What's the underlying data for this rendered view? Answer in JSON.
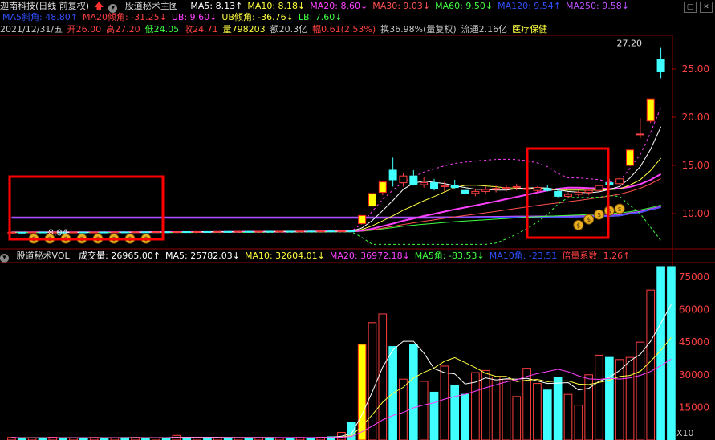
{
  "header": {
    "title": "迦南科技(日线 前复权)",
    "indicator_name": "股道秘术主图",
    "ma": [
      {
        "label": "MA5: 8.13↑",
        "color": "#ffffff"
      },
      {
        "label": "MA10: 8.18↓",
        "color": "#ffff40"
      },
      {
        "label": "MA20: 8.60↓",
        "color": "#ff40ff"
      },
      {
        "label": "MA30: 9.03↓",
        "color": "#ff5050"
      },
      {
        "label": "MA60: 9.50↓",
        "color": "#40ff40"
      },
      {
        "label": "MA120: 9.54↑",
        "color": "#3050ff"
      },
      {
        "label": "MA250: 9.58↓",
        "color": "#c050ff"
      }
    ],
    "row2": [
      {
        "label": "MA5斜角: 48.80↑",
        "color": "#3050ff"
      },
      {
        "label": "MA20倾角: -31.25↓",
        "color": "#ff4040"
      },
      {
        "label": "UB: 9.60↓",
        "color": "#ff40ff"
      },
      {
        "label": "UB倾角: -36.76↓",
        "color": "#ffff40"
      },
      {
        "label": "LB: 7.60↓",
        "color": "#40ff40"
      }
    ],
    "date": "2021/12/31/五",
    "quote": [
      {
        "label": "开26.00",
        "color": "#ff4040"
      },
      {
        "label": "高27.20",
        "color": "#ff4040"
      },
      {
        "label": "低24.05",
        "color": "#40ff40"
      },
      {
        "label": "收24.71",
        "color": "#ff4040"
      },
      {
        "label": "量798203",
        "color": "#ffff40"
      },
      {
        "label": "额20.3亿",
        "color": "#c8c8c8"
      },
      {
        "label": "幅0.61(2.53%)",
        "color": "#ff4040"
      },
      {
        "label": "换36.98%(量复权)",
        "color": "#c8c8c8"
      },
      {
        "label": "流通2.16亿",
        "color": "#c8c8c8"
      },
      {
        "label": "医疗保健",
        "color": "#ffff40"
      }
    ],
    "window_buttons": [
      "▢",
      "✕"
    ]
  },
  "volume_header": {
    "name": "股道秘术VOL",
    "items": [
      {
        "label": "成交量: 26965.00↑",
        "color": "#ffffff"
      },
      {
        "label": "MA5: 25782.03↓",
        "color": "#ffffff"
      },
      {
        "label": "MA10: 32604.01↓",
        "color": "#ffff40"
      },
      {
        "label": "MA20: 36972.18↓",
        "color": "#ff40ff"
      },
      {
        "label": "MA5角: -83.53↓",
        "color": "#40ff40"
      },
      {
        "label": "MA10角: -23.51",
        "color": "#3050ff"
      },
      {
        "label": "倍量系数: 1.26↑",
        "color": "#ff4040"
      }
    ],
    "multiplier": "X10"
  },
  "chart_data": [
    {
      "type": "candlestick",
      "title": "股道秘术主图",
      "ylim": [
        6.5,
        28.5
      ],
      "yticks": [
        "25.00",
        "20.00",
        "15.00",
        "10.00"
      ],
      "ytick_values": [
        25,
        20,
        15,
        10
      ],
      "annotations": [
        {
          "text": "27.20",
          "value": 27.2
        },
        {
          "text": "8.04",
          "value": 8.04
        }
      ],
      "candles": [
        [
          8.05,
          8.1,
          8.0,
          8.06
        ],
        [
          8.06,
          8.12,
          8.0,
          8.04
        ],
        [
          8.04,
          8.1,
          7.98,
          8.08
        ],
        [
          8.08,
          8.12,
          8.02,
          8.05
        ],
        [
          8.05,
          8.1,
          8.0,
          8.07
        ],
        [
          8.07,
          8.13,
          8.02,
          8.05
        ],
        [
          8.05,
          8.1,
          8.0,
          8.08
        ],
        [
          8.08,
          8.12,
          8.03,
          8.06
        ],
        [
          8.06,
          8.11,
          8.01,
          8.08
        ],
        [
          8.08,
          8.13,
          8.04,
          8.07
        ],
        [
          8.07,
          8.12,
          8.02,
          8.09
        ],
        [
          8.09,
          8.14,
          8.05,
          8.08
        ],
        [
          8.08,
          8.12,
          8.04,
          8.1
        ],
        [
          8.1,
          8.15,
          8.06,
          8.09
        ],
        [
          8.09,
          8.13,
          8.05,
          8.11
        ],
        [
          8.11,
          8.16,
          8.07,
          8.1
        ],
        [
          8.1,
          8.14,
          8.06,
          8.12
        ],
        [
          8.12,
          8.17,
          8.08,
          8.11
        ],
        [
          8.11,
          8.16,
          8.07,
          8.13
        ],
        [
          8.13,
          8.18,
          8.09,
          8.12
        ],
        [
          8.12,
          8.17,
          8.08,
          8.14
        ],
        [
          8.14,
          8.19,
          8.1,
          8.13
        ],
        [
          8.13,
          8.18,
          8.09,
          8.15
        ],
        [
          8.15,
          8.2,
          8.11,
          8.14
        ],
        [
          8.14,
          8.19,
          8.1,
          8.16
        ],
        [
          8.16,
          8.21,
          8.12,
          8.15
        ],
        [
          8.15,
          8.2,
          8.11,
          8.17
        ],
        [
          8.17,
          8.22,
          8.13,
          8.16
        ],
        [
          8.16,
          8.21,
          8.12,
          8.18
        ],
        [
          8.18,
          8.23,
          8.14,
          8.17
        ],
        [
          8.17,
          8.22,
          8.13,
          8.19
        ],
        [
          8.19,
          8.24,
          8.15,
          8.18
        ],
        [
          8.18,
          8.23,
          8.14,
          8.2
        ],
        [
          8.2,
          8.25,
          8.16,
          8.19
        ],
        [
          8.95,
          9.8,
          8.9,
          9.8
        ],
        [
          10.78,
          12.08,
          10.7,
          12.08
        ],
        [
          12.2,
          13.28,
          11.9,
          13.28
        ],
        [
          14.5,
          15.8,
          12.8,
          13.5
        ],
        [
          13.2,
          14.2,
          12.8,
          13.9
        ],
        [
          13.9,
          14.5,
          12.9,
          13.0
        ],
        [
          13.0,
          13.8,
          12.7,
          13.2
        ],
        [
          13.2,
          13.6,
          12.4,
          12.6
        ],
        [
          12.8,
          13.3,
          12.3,
          12.9
        ],
        [
          12.9,
          13.5,
          12.6,
          12.7
        ],
        [
          12.4,
          12.8,
          11.9,
          12.1
        ],
        [
          12.1,
          12.6,
          11.8,
          12.3
        ],
        [
          12.3,
          12.8,
          12.0,
          12.5
        ],
        [
          12.5,
          12.9,
          12.2,
          12.6
        ],
        [
          12.6,
          13.0,
          12.3,
          12.7
        ],
        [
          12.7,
          13.1,
          12.4,
          12.8
        ],
        [
          12.5,
          12.9,
          12.3,
          12.6
        ],
        [
          12.4,
          12.8,
          12.2,
          12.7
        ],
        [
          12.6,
          13.0,
          12.3,
          12.4
        ],
        [
          12.3,
          12.6,
          11.7,
          11.8
        ],
        [
          11.8,
          12.2,
          11.6,
          12.0
        ],
        [
          12.0,
          12.4,
          11.8,
          12.2
        ],
        [
          12.2,
          12.6,
          11.9,
          12.4
        ],
        [
          12.4,
          13.0,
          12.2,
          12.9
        ],
        [
          13.2,
          13.6,
          12.8,
          13.0
        ],
        [
          13.1,
          13.8,
          12.9,
          13.6
        ],
        [
          15.0,
          16.6,
          14.9,
          16.6
        ],
        [
          18.26,
          19.9,
          17.8,
          18.26
        ],
        [
          19.6,
          21.9,
          19.4,
          21.9
        ],
        [
          26.0,
          27.2,
          24.05,
          24.71
        ]
      ]
    },
    {
      "type": "bar",
      "title": "股道秘术VOL",
      "ylim": [
        0,
        82000
      ],
      "yticks": [
        "75000",
        "60000",
        "45000",
        "30000",
        "15000"
      ],
      "ytick_values": [
        75000,
        60000,
        45000,
        30000,
        15000
      ],
      "values": [
        1200,
        900,
        1000,
        1100,
        1300,
        1000,
        950,
        1050,
        1200,
        1100,
        1000,
        1150,
        1200,
        1000,
        1100,
        1050,
        2100,
        1200,
        1100,
        1000,
        1100,
        1200,
        1000,
        1100,
        1050,
        1150,
        1000,
        1100,
        1200,
        1100,
        1300,
        1500,
        3500,
        8000,
        44000,
        54000,
        58000,
        43000,
        28000,
        44000,
        27000,
        22000,
        34000,
        25000,
        21000,
        31000,
        32000,
        29000,
        28000,
        20000,
        33000,
        26000,
        23000,
        29000,
        21000,
        16000,
        30000,
        39000,
        38000,
        37000,
        38000,
        45000,
        69000,
        79800,
        79800
      ]
    }
  ]
}
